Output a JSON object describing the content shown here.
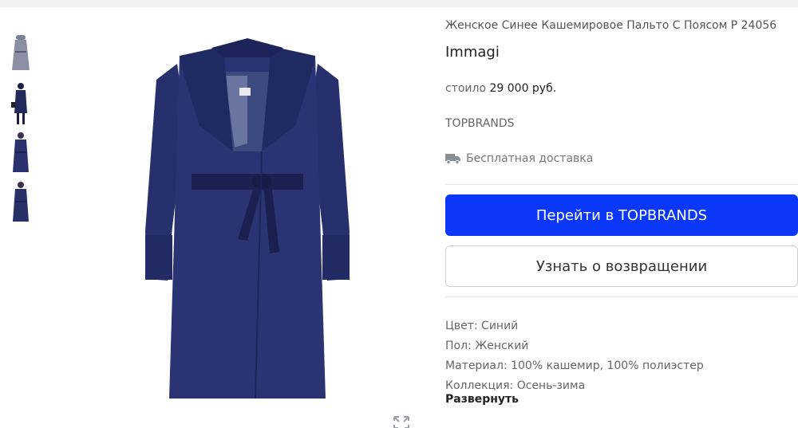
{
  "product": {
    "title": "Женское Синее Кашемировое Пальто С Поясом Р 24056",
    "brand": "Immagi",
    "price_prefix": "стоило",
    "price_value": "29 000 руб.",
    "shop": "TOPBRANDS",
    "delivery": "Бесплатная доставка"
  },
  "actions": {
    "go_to_shop": "Перейти в TOPBRANDS",
    "notify_return": "Узнать о возвращении"
  },
  "specs": [
    "Цвет: Синий",
    "Пол: Женский",
    "Материал: 100% кашемир, 100% полиэстер",
    "Коллекция: Осень-зима"
  ],
  "expand_label": "Развернуть",
  "colors": {
    "accent": "#0a37f8",
    "coat": "#27306e"
  },
  "icons": [
    "truck-icon",
    "expand-icon"
  ]
}
